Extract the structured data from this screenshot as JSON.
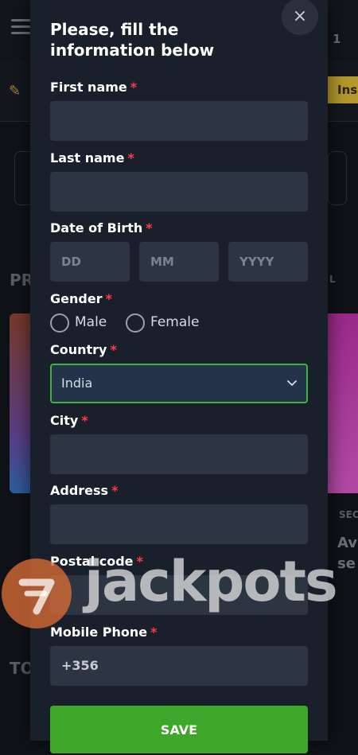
{
  "background": {
    "account_indicator": "1",
    "install_label": "Ins",
    "section_label_1": "PR",
    "section_label_right": "L",
    "section_label_sec": "SEC",
    "promo_text": "Av\nse",
    "section_label_2": "TO"
  },
  "modal": {
    "title": "Please, fill the information below",
    "close_icon": "×",
    "required_mark": "*",
    "first_name": {
      "label": "First name",
      "value": ""
    },
    "last_name": {
      "label": "Last name",
      "value": ""
    },
    "dob": {
      "label": "Date of Birth",
      "day_placeholder": "DD",
      "month_placeholder": "MM",
      "year_placeholder": "YYYY"
    },
    "gender": {
      "label": "Gender",
      "options": [
        "Male",
        "Female"
      ]
    },
    "country": {
      "label": "Country",
      "value": "India"
    },
    "city": {
      "label": "City",
      "value": ""
    },
    "address": {
      "label": "Address",
      "value": ""
    },
    "postal_code": {
      "label": "Postal code",
      "value": ""
    },
    "mobile_phone": {
      "label": "Mobile Phone",
      "value": "+356"
    },
    "save_label": "SAVE"
  },
  "watermark": {
    "text": "jackpots"
  },
  "colors": {
    "accent_green": "#3ea629",
    "focus_border": "#3fb33a",
    "required_red": "#ff3b4a",
    "modal_bg": "#1a202b",
    "input_bg": "#2d3542"
  }
}
